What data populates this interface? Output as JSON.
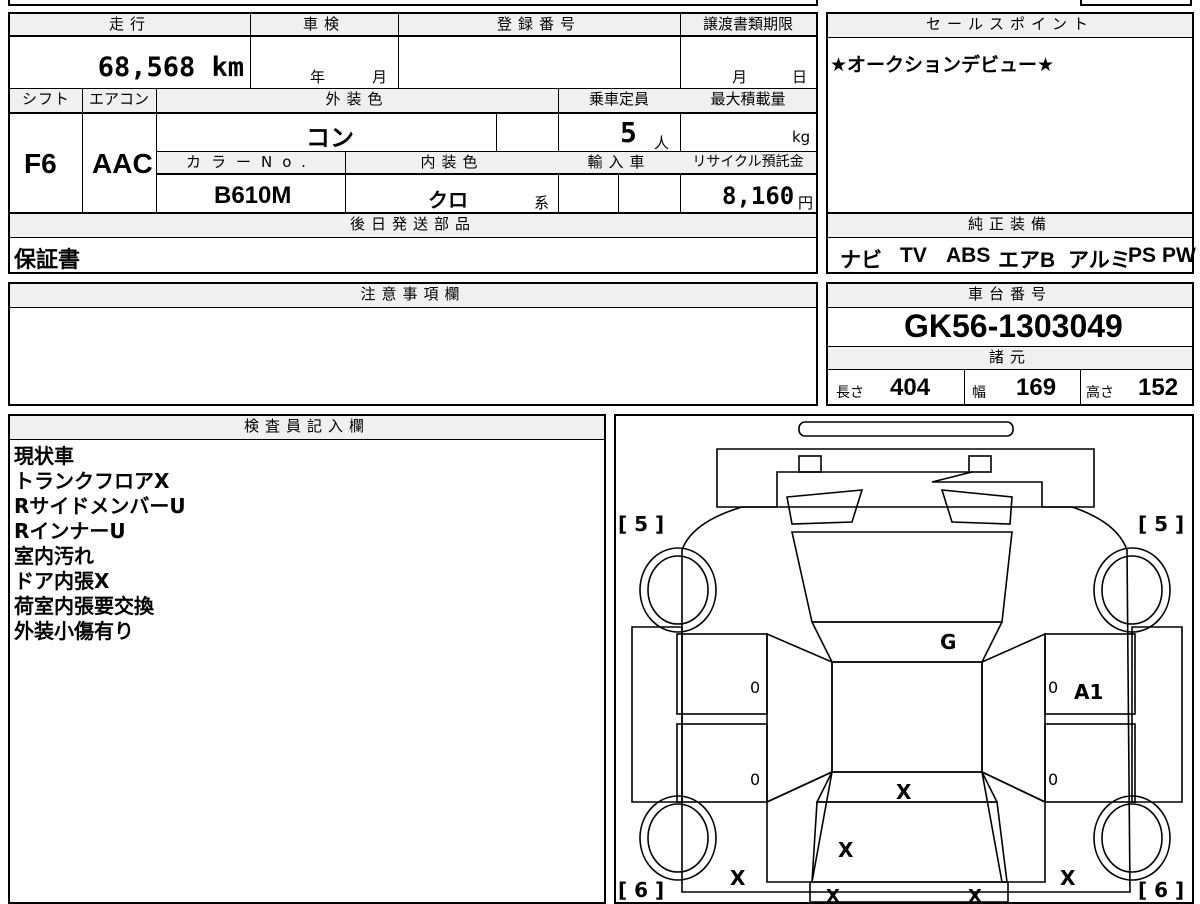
{
  "specs_top": {
    "mileage_label": "走行",
    "inspection_label": "車検",
    "registration_label": "登録番号",
    "transfer_deadline_label": "譲渡書類期限",
    "mileage_value": "68,568 km",
    "inspection_year_unit": "年",
    "inspection_month_unit": "月",
    "deadline_month_unit": "月",
    "deadline_day_unit": "日",
    "shift_label": "シフト",
    "ac_label": "エアコン",
    "exterior_color_label": "外装色",
    "capacity_label": "乗車定員",
    "max_load_label": "最大積載量",
    "shift_value": "F6",
    "ac_value": "AAC",
    "exterior_color_value": "コン",
    "capacity_value": "5",
    "capacity_unit": "人",
    "max_load_unit": "kg",
    "color_no_label": "カラーNo.",
    "interior_color_label": "内装色",
    "import_label": "輸入車",
    "recycle_label": "リサイクル預託金",
    "color_no_value": "B610M",
    "interior_color_value": "クロ",
    "interior_color_suffix": "系",
    "recycle_value": "8,160",
    "recycle_unit": "円"
  },
  "selling_points": {
    "label": "セールスポイント",
    "text": "★オークションデビュー★"
  },
  "later_parts": {
    "label": "後日発送部品",
    "text": "保証書"
  },
  "equipment": {
    "label": "純正装備",
    "items": [
      "ナビ",
      "TV",
      "ABS",
      "エアB",
      "アルミ",
      "PS",
      "PW"
    ]
  },
  "notes": {
    "label": "注意事項欄"
  },
  "chassis": {
    "label": "車台番号",
    "number": "GK56-1303049",
    "specs_label": "諸元",
    "length_label": "長さ",
    "length_value": "404",
    "width_label": "幅",
    "width_value": "169",
    "height_label": "高さ",
    "height_value": "152"
  },
  "inspector": {
    "label": "検査員記入欄",
    "lines": [
      "現状車",
      "トランクフロアX",
      "RサイドメンバーU",
      "RインナーU",
      "室内汚れ",
      "ドア内張X",
      "荷室内張要交換",
      "外装小傷有り"
    ]
  },
  "diagram": {
    "tire_fl": "[ 5 ]",
    "tire_fr": "[ 5 ]",
    "tire_rl": "[ 6 ]",
    "tire_rr": "[ 6 ]",
    "mark_hood": "G",
    "mark_right_front": "A1",
    "mark_left_front_zero": "0",
    "mark_left_rear_zero": "0",
    "mark_right_front_zero": "0",
    "mark_right_rear_zero": "0",
    "mark_roof": "X",
    "mark_tailgate": "X",
    "mark_left_rear": "X",
    "mark_right_rear": "X",
    "mark_bottom_left": "X",
    "mark_bottom_right": "X"
  }
}
